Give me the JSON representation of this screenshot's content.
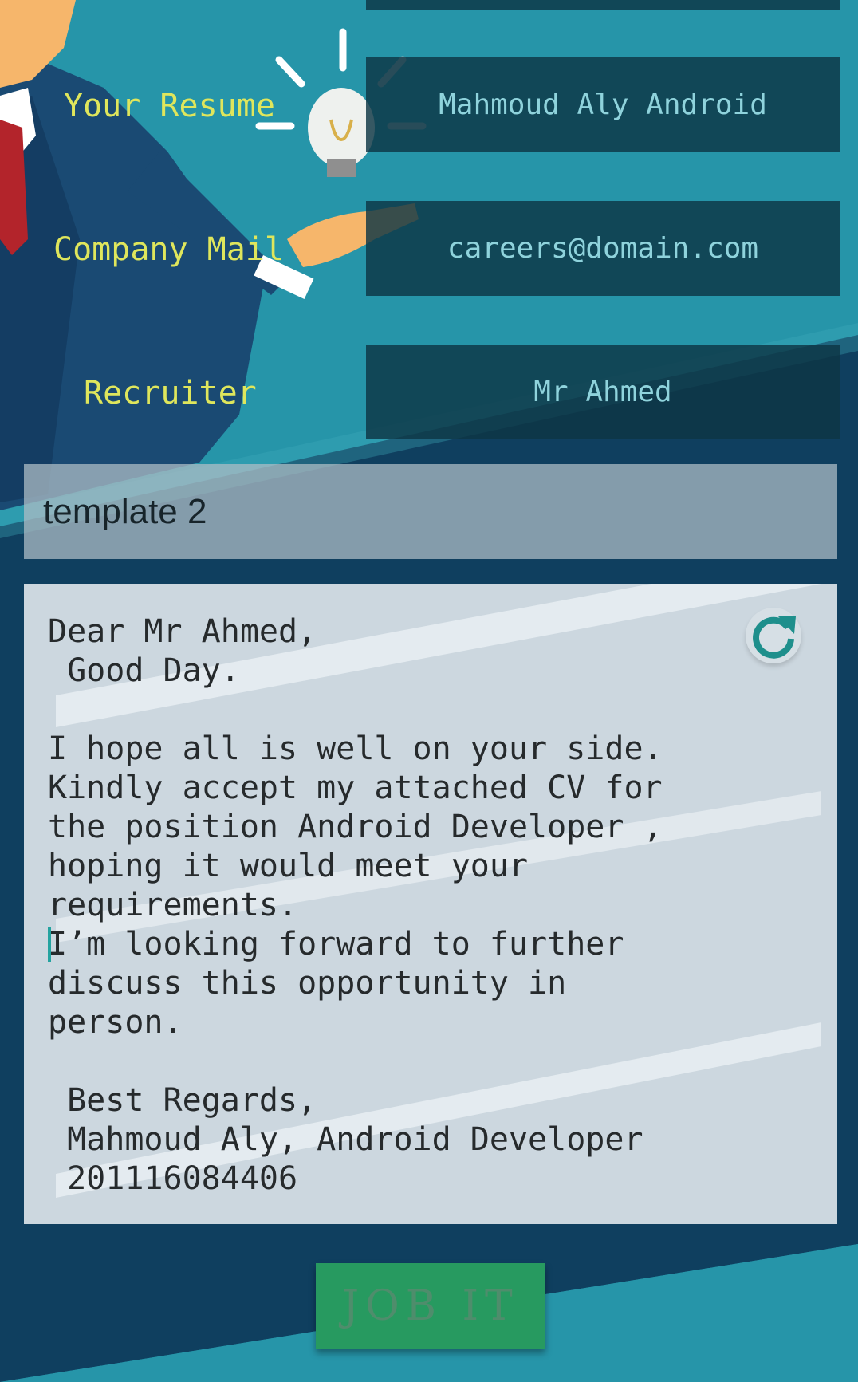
{
  "form": {
    "resume_label": "Your Resume",
    "resume_value": "Mahmoud Aly Android",
    "mail_label": "Company Mail",
    "mail_value": "careers@domain.com",
    "recruiter_label": "Recruiter",
    "recruiter_value": "Mr Ahmed"
  },
  "template": {
    "selected": "template 2"
  },
  "letter": {
    "body": "Dear Mr Ahmed,\n Good Day.\n\nI hope all is well on your side.\nKindly accept my attached CV for\nthe position Android Developer ,\nhoping it would meet your\nrequirements.\nI’m looking forward to further\ndiscuss this opportunity in\nperson.\n\n Best Regards,\n Mahmoud Aly, Android Developer\n 201116084406",
    "refresh_icon": "refresh-icon"
  },
  "actions": {
    "submit_label": "JOB IT"
  },
  "colors": {
    "background": "#2695a9",
    "label": "#dfe65c",
    "field_text": "#8fd3dc",
    "button": "#279a60"
  }
}
